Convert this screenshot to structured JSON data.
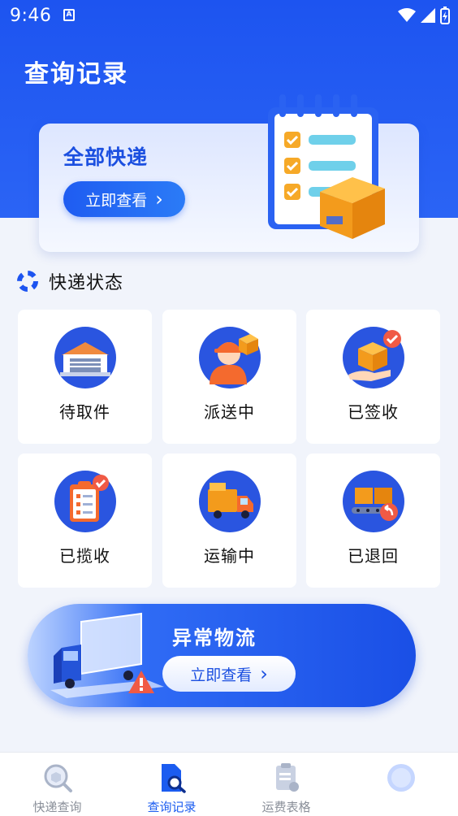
{
  "status_bar": {
    "time": "9:46"
  },
  "header": {
    "title": "查询记录"
  },
  "banner": {
    "title": "全部快递",
    "button_label": "立即查看",
    "button_arrow": "›"
  },
  "status_section": {
    "title": "快递状态",
    "items": [
      {
        "label": "待取件",
        "icon": "warehouse-icon"
      },
      {
        "label": "派送中",
        "icon": "courier-icon"
      },
      {
        "label": "已签收",
        "icon": "signed-package-icon"
      },
      {
        "label": "已揽收",
        "icon": "checklist-icon"
      },
      {
        "label": "运输中",
        "icon": "truck-icon"
      },
      {
        "label": "已退回",
        "icon": "return-package-icon"
      }
    ]
  },
  "abnormal": {
    "title": "异常物流",
    "button_label": "立即查看",
    "button_arrow": "›"
  },
  "bottom_nav": {
    "items": [
      {
        "label": "快递查询",
        "active": false
      },
      {
        "label": "查询记录",
        "active": true
      },
      {
        "label": "运费表格",
        "active": false
      },
      {
        "label": "",
        "active": false
      }
    ]
  },
  "colors": {
    "primary": "#1d54f0",
    "accent_orange": "#f5a623",
    "background": "#f1f4fb"
  }
}
